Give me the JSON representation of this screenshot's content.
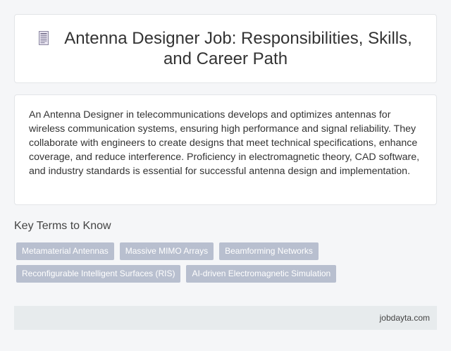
{
  "header": {
    "title": "Antenna Designer Job: Responsibilities, Skills, and Career Path",
    "icon": "document-icon"
  },
  "summary": {
    "text": "An Antenna Designer in telecommunications develops and optimizes antennas for wireless communication systems, ensuring high performance and signal reliability. They collaborate with engineers to create designs that meet technical specifications, enhance coverage, and reduce interference. Proficiency in electromagnetic theory, CAD software, and industry standards is essential for successful antenna design and implementation."
  },
  "key_terms": {
    "heading": "Key Terms to Know",
    "tags": [
      "Metamaterial Antennas",
      "Massive MIMO Arrays",
      "Beamforming Networks",
      "Reconfigurable Intelligent Surfaces (RIS)",
      "AI-driven Electromagnetic Simulation"
    ]
  },
  "footer": {
    "source": "jobdayta.com"
  },
  "colors": {
    "tag_bg": "#b8bfcf",
    "footer_bg": "#e7ebed",
    "page_bg": "#f5f6f8"
  }
}
